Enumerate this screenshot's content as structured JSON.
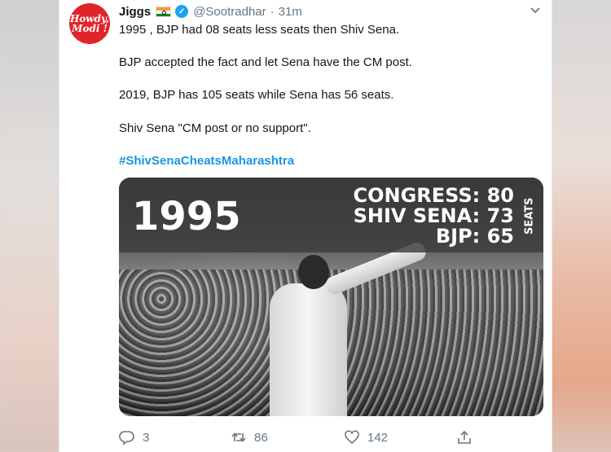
{
  "tweet": {
    "avatar_text_line1": "Howdy,",
    "avatar_text_line2": "Modi !",
    "name": "Jiggs",
    "handle": "@Sootradhar",
    "separator": "·",
    "time": "31m",
    "lines": [
      "1995 , BJP had 08 seats less seats then Shiv Sena.",
      "BJP accepted the fact and let Sena have the CM post.",
      "2019, BJP has 105 seats while Sena has 56 seats.",
      "Shiv Sena \"CM post or no support\"."
    ],
    "hashtag": "#ShivSenaCheatsMaharashtra"
  },
  "image": {
    "year": "1995",
    "stats": [
      "CONGRESS: 80",
      "SHIV SENA: 73",
      "BJP: 65"
    ],
    "side_label": "SEATS"
  },
  "actions": {
    "reply_count": "3",
    "retweet_count": "86",
    "like_count": "142"
  },
  "icons": {
    "reply": "reply-icon",
    "retweet": "retweet-icon",
    "like": "heart-icon",
    "share": "share-icon",
    "caret": "chevron-down-icon",
    "verified": "verified-badge-icon",
    "flag": "india-flag-icon"
  },
  "colors": {
    "link": "#1b95e0",
    "verified": "#1da1f2",
    "avatar": "#e0252a",
    "muted": "#657786"
  }
}
